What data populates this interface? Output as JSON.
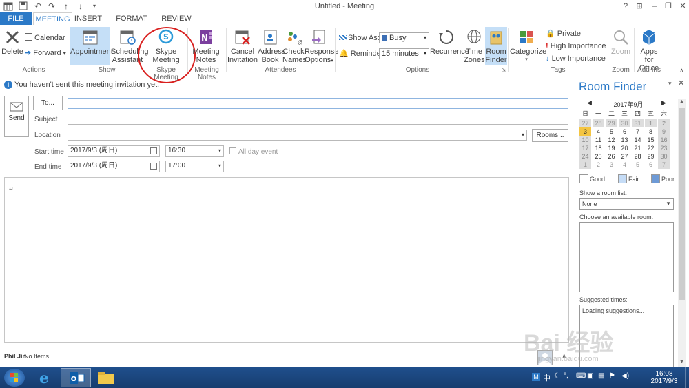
{
  "window": {
    "title": "Untitled - Meeting",
    "help": "?",
    "restore_ribbon": "⊞",
    "minimize": "–",
    "maximize": "❐",
    "close": "✕"
  },
  "tabs": [
    "FILE",
    "MEETING",
    "INSERT",
    "FORMAT TEXT",
    "REVIEW"
  ],
  "ribbon": {
    "actions": {
      "delete": "Delete",
      "calendar": "Calendar",
      "forward": "Forward",
      "group": "Actions"
    },
    "show": {
      "appointment": "Appointment",
      "scheduling_1": "Scheduling",
      "scheduling_2": "Assistant",
      "group": "Show"
    },
    "skype": {
      "line1": "Skype",
      "line2": "Meeting",
      "group": "Skype Meeting"
    },
    "notes": {
      "line1": "Meeting",
      "line2": "Notes",
      "group": "Meeting Notes"
    },
    "attendees": {
      "cancel_1": "Cancel",
      "cancel_2": "Invitation",
      "address_1": "Address",
      "address_2": "Book",
      "check_1": "Check",
      "check_2": "Names",
      "response_1": "Response",
      "response_2": "Options",
      "group": "Attendees"
    },
    "options": {
      "show_as": "Show As:",
      "show_as_value": "Busy",
      "reminder": "Reminder:",
      "reminder_value": "15 minutes",
      "recurrence": "Recurrence",
      "time_1": "Time",
      "time_2": "Zones",
      "room_1": "Room",
      "room_2": "Finder",
      "group": "Options"
    },
    "tags": {
      "categorize": "Categorize",
      "private": "Private",
      "high": "High Importance",
      "low": "Low Importance",
      "group": "Tags"
    },
    "zoom": {
      "zoom": "Zoom",
      "group": "Zoom"
    },
    "addins": {
      "apps_1": "Apps for",
      "apps_2": "Office",
      "group": "Add-ins"
    }
  },
  "infobar": {
    "message": "You haven't sent this meeting invitation yet."
  },
  "form": {
    "send": "Send",
    "to": "To...",
    "subject": "Subject",
    "location": "Location",
    "rooms": "Rooms...",
    "start_time": "Start time",
    "end_time": "End time",
    "start_date": "2017/9/3 (周日)",
    "end_date": "2017/9/3 (周日)",
    "start_clock": "16:30",
    "end_clock": "17:00",
    "all_day": "All day event",
    "body_mark": "↵"
  },
  "people": {
    "name": "Phil Jin",
    "items": "No Items"
  },
  "room_finder": {
    "title": "Room Finder",
    "month": "2017年9月",
    "weekdays": [
      "日",
      "一",
      "二",
      "三",
      "四",
      "五",
      "六"
    ],
    "weeks": [
      [
        "27",
        "28",
        "29",
        "30",
        "31",
        "1",
        "2"
      ],
      [
        "3",
        "4",
        "5",
        "6",
        "7",
        "8",
        "9"
      ],
      [
        "10",
        "11",
        "12",
        "13",
        "14",
        "15",
        "16"
      ],
      [
        "17",
        "18",
        "19",
        "20",
        "21",
        "22",
        "23"
      ],
      [
        "24",
        "25",
        "26",
        "27",
        "28",
        "29",
        "30"
      ],
      [
        "1",
        "2",
        "3",
        "4",
        "5",
        "6",
        "7"
      ]
    ],
    "legend_good": "Good",
    "legend_fair": "Fair",
    "legend_poor": "Poor",
    "show_room_list": "Show a room list:",
    "room_list_value": "None",
    "choose_room": "Choose an available room:",
    "suggested_times": "Suggested times:",
    "loading": "Loading suggestions..."
  },
  "taskbar": {
    "time": "16:08",
    "date": "2017/9/3",
    "ime": "中"
  },
  "watermark": {
    "brand": "Bai 经验",
    "url": "jingyan.baidu.com"
  },
  "colors": {
    "accent": "#2b79c7",
    "selected": "#c5dff7",
    "today": "#f4c542",
    "fair": "#c5dcf6",
    "poor": "#6d9ad6",
    "annotation": "#d9201f"
  }
}
